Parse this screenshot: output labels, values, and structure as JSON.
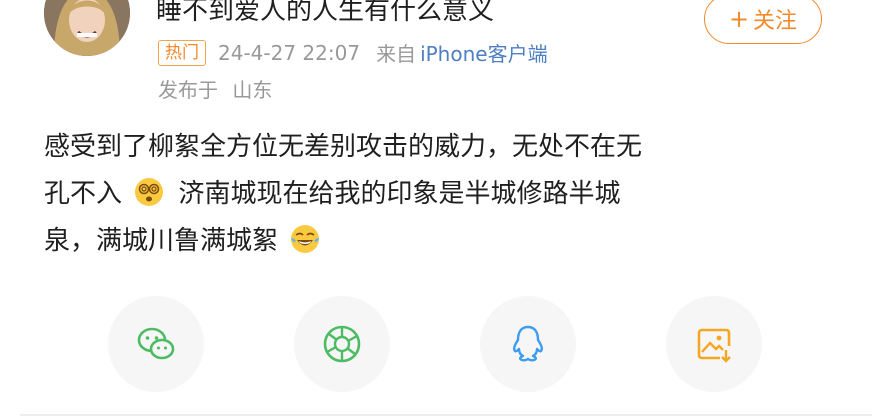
{
  "post": {
    "username": "睡不到爱人的人生有什么意义",
    "follow_label": "关注",
    "follow_plus": "+",
    "hot_badge": "热门",
    "timestamp": "24-4-27 22:07",
    "source_label": "来自",
    "source_device": "iPhone客户端",
    "location_prefix": "发布于",
    "location": "山东",
    "content": {
      "line1": "感受到了柳絮全方位无差别攻击的威力，无处不在无",
      "line2a": "孔不入",
      "line2b": "济南城现在给我的印象是半城修路半城",
      "line3": "泉，满城川鲁满城絮"
    },
    "emojis": [
      "dizzy-face-emoji",
      "tears-of-joy-emoji"
    ]
  },
  "share": {
    "targets": [
      "wechat-icon",
      "moments-icon",
      "qq-icon",
      "save-image-icon"
    ]
  },
  "colors": {
    "accent": "#f08a2c",
    "link": "#4e7fc2",
    "meta_text": "#999999",
    "icon_green": "#4cbc63",
    "icon_blue": "#3d9bf0",
    "icon_orange": "#f5a623"
  }
}
